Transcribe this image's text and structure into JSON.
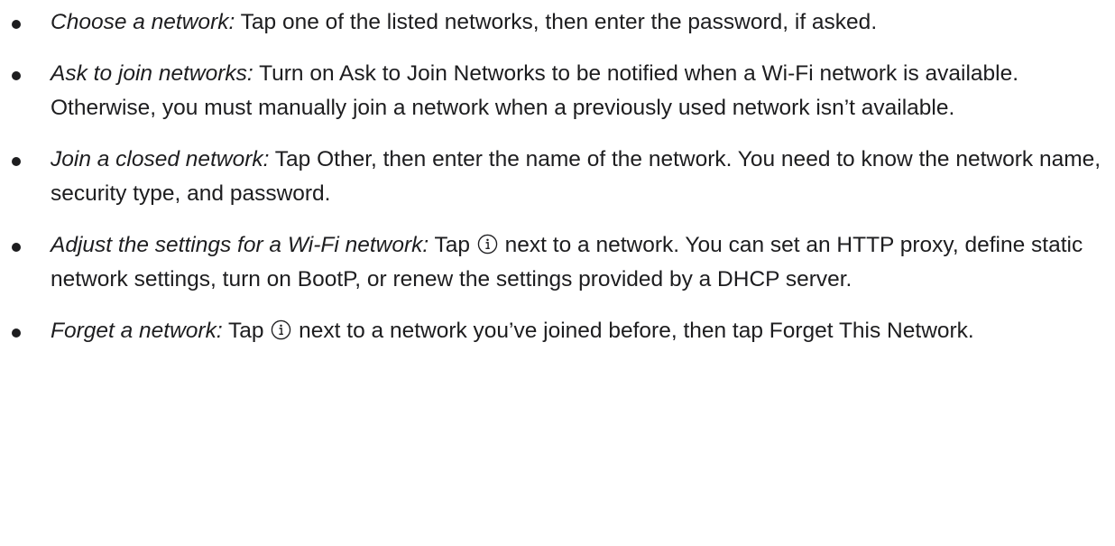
{
  "items": [
    {
      "term": "Choose a network:",
      "text": "Tap one of the listed networks, then enter the password, if asked."
    },
    {
      "term": "Ask to join networks:",
      "text": "Turn on Ask to Join Networks to be notified when a Wi-Fi network is available. Otherwise, you must manually join a network when a previously used network isn’t available."
    },
    {
      "term": "Join a closed network:",
      "text": "Tap Other, then enter the name of the network. You need to know the network name, security type, and password."
    },
    {
      "term": "Adjust the settings for a Wi-Fi network:",
      "before_icon": "Tap",
      "after_icon": "next to a network. You can set an HTTP proxy, define static network settings, turn on BootP, or renew the settings provided by a DHCP server."
    },
    {
      "term": "Forget a network:",
      "before_icon": "Tap",
      "after_icon": "next to a network you’ve joined before, then tap Forget This Network."
    }
  ],
  "icons": {
    "inline_info": "info-circle-icon"
  }
}
